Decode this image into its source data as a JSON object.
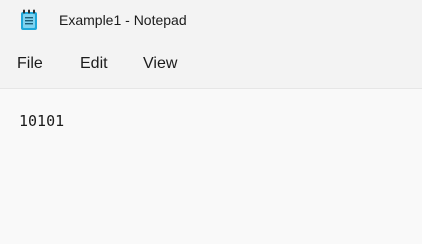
{
  "window": {
    "title": "Example1 - Notepad",
    "icon": "notepad-icon"
  },
  "menu": {
    "file_label": "File",
    "edit_label": "Edit",
    "view_label": "View"
  },
  "editor": {
    "content": "10101"
  },
  "colors": {
    "titlebar_bg": "#f3f3f3",
    "editor_bg": "#f9f9f9",
    "text": "#1b1b1b",
    "icon_accent": "#1ea7d9"
  }
}
